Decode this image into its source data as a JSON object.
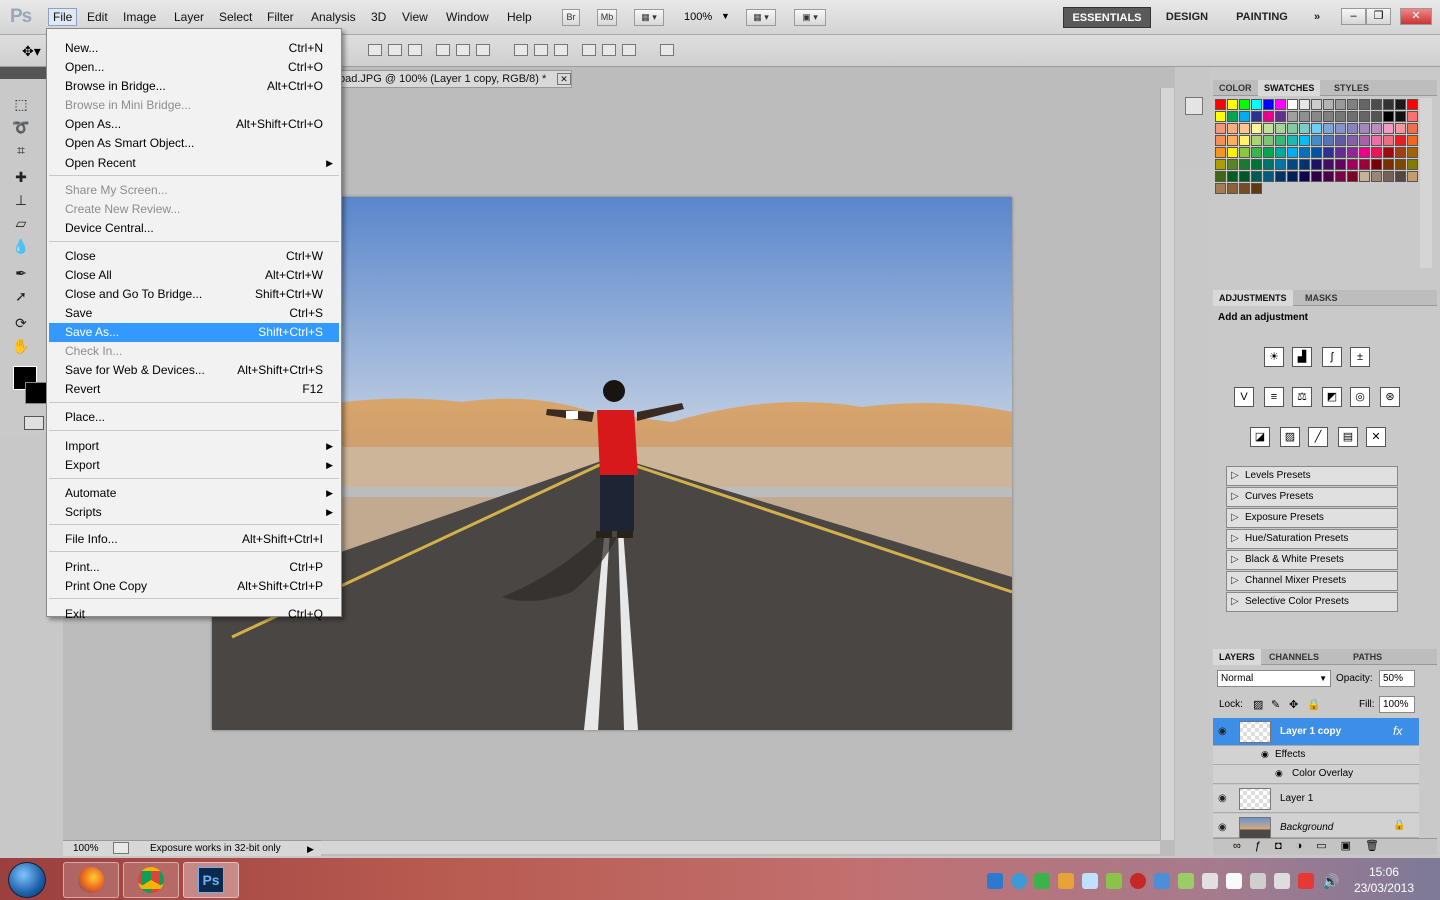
{
  "app": {
    "logo": "Ps"
  },
  "menubar": {
    "items": [
      "File",
      "Edit",
      "Image",
      "Layer",
      "Select",
      "Filter",
      "Analysis",
      "3D",
      "View",
      "Window",
      "Help"
    ],
    "toolbar": {
      "br": "Br",
      "mb": "Mb",
      "zoom": "100%"
    },
    "workspaces": {
      "essentials": "ESSENTIALS",
      "design": "DESIGN",
      "painting": "PAINTING",
      "more": "»"
    },
    "window_controls": [
      "–",
      "❐",
      "✕"
    ]
  },
  "document": {
    "tab_title": "oad.JPG @ 100% (Layer 1 copy, RGB/8) *",
    "close": "✕"
  },
  "status": {
    "zoom": "100%",
    "message": "Exposure works in 32-bit only"
  },
  "file_menu": {
    "items": [
      {
        "label": "New...",
        "shortcut": "Ctrl+N",
        "disabled": false
      },
      {
        "label": "Open...",
        "shortcut": "Ctrl+O",
        "disabled": false
      },
      {
        "label": "Browse in Bridge...",
        "shortcut": "Alt+Ctrl+O",
        "disabled": false
      },
      {
        "label": "Browse in Mini Bridge...",
        "shortcut": "",
        "disabled": true
      },
      {
        "label": "Open As...",
        "shortcut": "Alt+Shift+Ctrl+O",
        "disabled": false
      },
      {
        "label": "Open As Smart Object...",
        "shortcut": "",
        "disabled": false
      },
      {
        "label": "Open Recent",
        "shortcut": "",
        "submenu": true,
        "disabled": false
      },
      {
        "label": "Share My Screen...",
        "shortcut": "",
        "disabled": true
      },
      {
        "label": "Create New Review...",
        "shortcut": "",
        "disabled": true
      },
      {
        "label": "Device Central...",
        "shortcut": "",
        "disabled": false
      },
      {
        "label": "Close",
        "shortcut": "Ctrl+W",
        "disabled": false
      },
      {
        "label": "Close All",
        "shortcut": "Alt+Ctrl+W",
        "disabled": false
      },
      {
        "label": "Close and Go To Bridge...",
        "shortcut": "Shift+Ctrl+W",
        "disabled": false
      },
      {
        "label": "Save",
        "shortcut": "Ctrl+S",
        "disabled": false
      },
      {
        "label": "Save As...",
        "shortcut": "Shift+Ctrl+S",
        "disabled": false,
        "highlighted": true
      },
      {
        "label": "Check In...",
        "shortcut": "",
        "disabled": true
      },
      {
        "label": "Save for Web & Devices...",
        "shortcut": "Alt+Shift+Ctrl+S",
        "disabled": false
      },
      {
        "label": "Revert",
        "shortcut": "F12",
        "disabled": false
      },
      {
        "label": "Place...",
        "shortcut": "",
        "disabled": false
      },
      {
        "label": "Import",
        "shortcut": "",
        "submenu": true,
        "disabled": false
      },
      {
        "label": "Export",
        "shortcut": "",
        "submenu": true,
        "disabled": false
      },
      {
        "label": "Automate",
        "shortcut": "",
        "submenu": true,
        "disabled": false
      },
      {
        "label": "Scripts",
        "shortcut": "",
        "submenu": true,
        "disabled": false
      },
      {
        "label": "File Info...",
        "shortcut": "Alt+Shift+Ctrl+I",
        "disabled": false
      },
      {
        "label": "Print...",
        "shortcut": "Ctrl+P",
        "disabled": false
      },
      {
        "label": "Print One Copy",
        "shortcut": "Alt+Shift+Ctrl+P",
        "disabled": false
      },
      {
        "label": "Exit",
        "shortcut": "Ctrl+Q",
        "disabled": false
      }
    ]
  },
  "color_panel": {
    "tabs": [
      "COLOR",
      "SWATCHES",
      "STYLES"
    ],
    "active_tab": "SWATCHES"
  },
  "adjustments_panel": {
    "tabs": [
      "ADJUSTMENTS",
      "MASKS"
    ],
    "heading": "Add an adjustment",
    "presets": [
      "Levels Presets",
      "Curves Presets",
      "Exposure Presets",
      "Hue/Saturation Presets",
      "Black & White Presets",
      "Channel Mixer Presets",
      "Selective Color Presets"
    ]
  },
  "layers_panel": {
    "tabs": [
      "LAYERS",
      "CHANNELS",
      "PATHS"
    ],
    "blend_mode": "Normal",
    "opacity_label": "Opacity:",
    "opacity": "50%",
    "lock_label": "Lock:",
    "fill_label": "Fill:",
    "fill": "100%",
    "layers": [
      {
        "name": "Layer 1 copy",
        "selected": true,
        "fx": "fx"
      },
      {
        "name": "Effects",
        "sub": true
      },
      {
        "name": "Color Overlay",
        "sub": true
      },
      {
        "name": "Layer 1"
      },
      {
        "name": "Background",
        "locked": true
      }
    ]
  },
  "taskbar": {
    "time": "15:06",
    "date": "23/03/2013",
    "ps_label": "Ps"
  },
  "colors": {
    "highlight": "#3399ff",
    "layer_selected": "#3d8ee6"
  }
}
